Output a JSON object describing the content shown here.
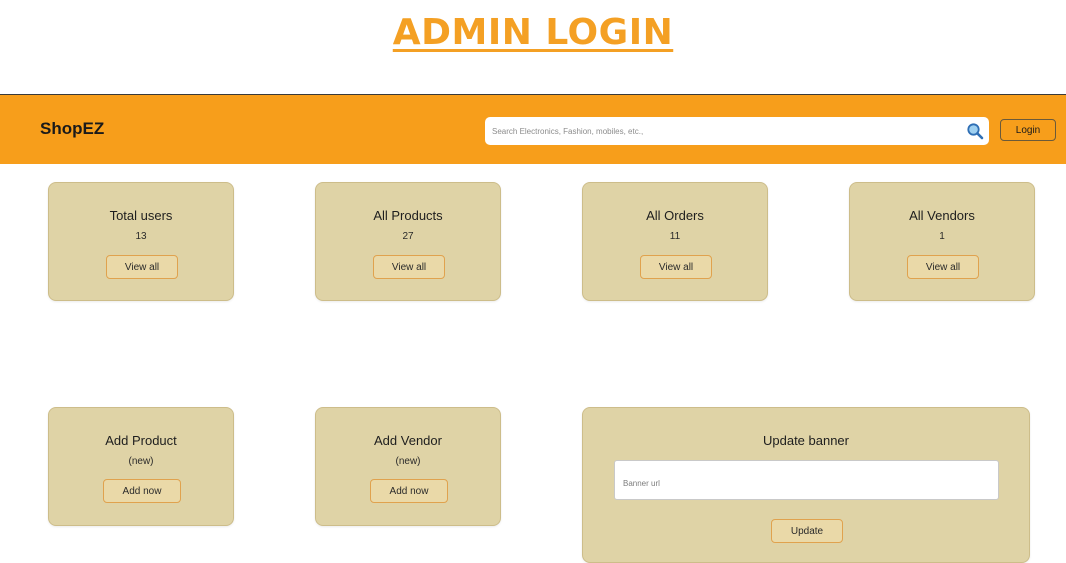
{
  "page_title": "ADMIN LOGIN",
  "navbar": {
    "brand": "ShopEZ",
    "search_placeholder": "Search Electronics, Fashion, mobiles, etc.,",
    "search_icon": "search-icon",
    "login_label": "Login",
    "background_color": "#f79e1b"
  },
  "stats": [
    {
      "title": "Total users",
      "value": "13",
      "button": "View all"
    },
    {
      "title": "All Products",
      "value": "27",
      "button": "View all"
    },
    {
      "title": "All Orders",
      "value": "11",
      "button": "View all"
    },
    {
      "title": "All Vendors",
      "value": "1",
      "button": "View all"
    }
  ],
  "add_cards": [
    {
      "title": "Add Product",
      "subtitle": "(new)",
      "button": "Add now"
    },
    {
      "title": "Add Vendor",
      "subtitle": "(new)",
      "button": "Add now"
    }
  ],
  "banner": {
    "title": "Update banner",
    "input_placeholder": "Banner url",
    "button": "Update"
  },
  "colors": {
    "accent": "#f4a024",
    "card_background": "#dfd3a6",
    "button_border": "#e0a24e"
  }
}
